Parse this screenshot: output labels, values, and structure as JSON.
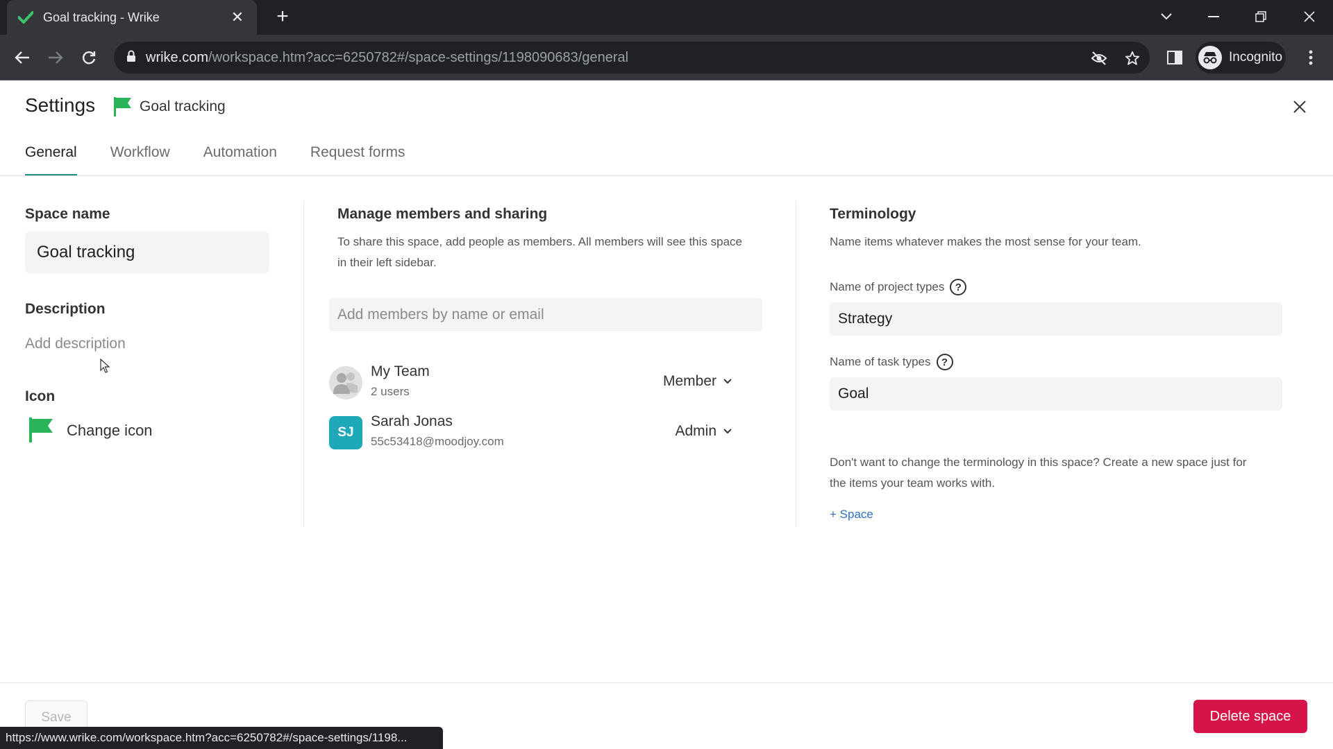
{
  "browser": {
    "tab_title": "Goal tracking - Wrike",
    "url_host": "wrike.com",
    "url_path": "/workspace.htm?acc=6250782#/space-settings/1198090683/general",
    "profile_label": "Incognito",
    "status_url": "https://www.wrike.com/workspace.htm?acc=6250782#/space-settings/1198..."
  },
  "header": {
    "title": "Settings",
    "space_name": "Goal tracking",
    "flag_color": "#2bb35a"
  },
  "tabs": [
    {
      "label": "General",
      "active": true
    },
    {
      "label": "Workflow",
      "active": false
    },
    {
      "label": "Automation",
      "active": false
    },
    {
      "label": "Request forms",
      "active": false
    }
  ],
  "general": {
    "space_name_label": "Space name",
    "space_name_value": "Goal tracking",
    "description_label": "Description",
    "description_placeholder": "Add description",
    "icon_label": "Icon",
    "change_icon_label": "Change icon"
  },
  "members": {
    "heading": "Manage members and sharing",
    "description_line1": "To share this space, add people as members. All members will see this space",
    "description_line2": "in their left sidebar.",
    "search_placeholder": "Add members by name or email",
    "list": [
      {
        "name": "My Team",
        "sub": "2 users",
        "role": "Member",
        "avatar": "team-icon"
      },
      {
        "name": "Sarah Jonas",
        "sub": "55c53418@moodjoy.com",
        "role": "Admin",
        "initials": "SJ",
        "avatar_color": "#1fa8b8"
      }
    ]
  },
  "terminology": {
    "heading": "Terminology",
    "subtitle": "Name items whatever makes the most sense for your team.",
    "project_types_label": "Name of project types",
    "project_types_value": "Strategy",
    "task_types_label": "Name of task types",
    "task_types_value": "Goal",
    "note_line1": "Don't want to change the terminology in this space? Create a new space just for",
    "note_line2": "the items your team works with.",
    "add_space_link": "+ Space",
    "help_glyph": "?"
  },
  "footer": {
    "save_label": "Save",
    "delete_label": "Delete space",
    "delete_color": "#d6144a"
  }
}
